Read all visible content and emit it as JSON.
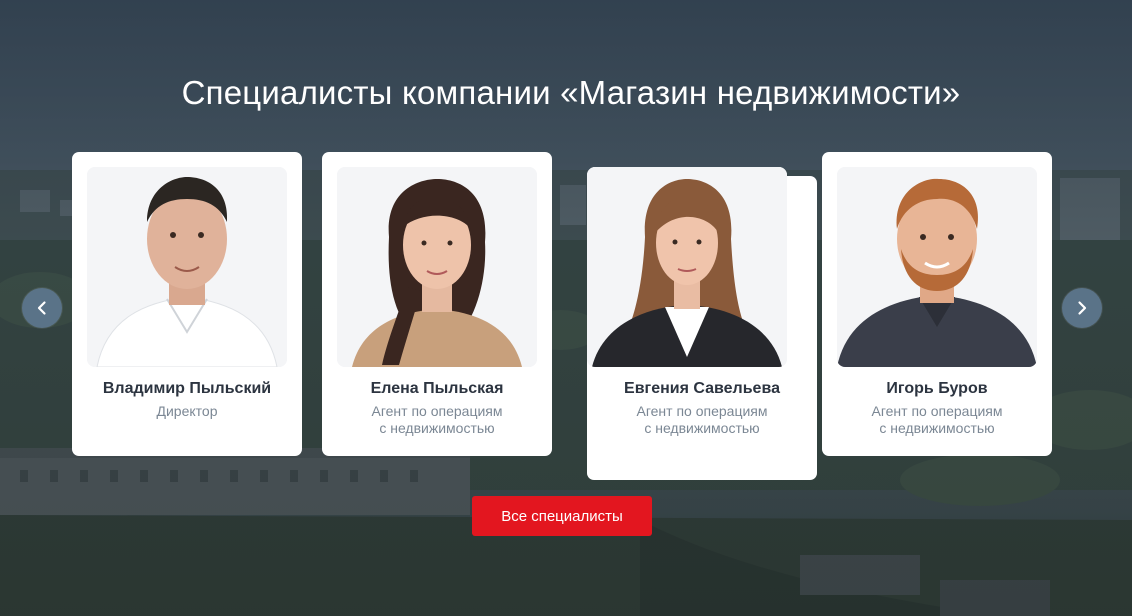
{
  "section": {
    "title": "Специалисты компании «Магазин недвижимости»"
  },
  "specialists": [
    {
      "name": "Владимир Пыльский",
      "role_line1": "Директор",
      "role_line2": ""
    },
    {
      "name": "Елена Пыльская",
      "role_line1": "Агент по операциям",
      "role_line2": "с недвижимостью"
    },
    {
      "name": "Евгения Савельева",
      "role_line1": "Агент по операциям",
      "role_line2": "с недвижимостью"
    },
    {
      "name": "Игорь Буров",
      "role_line1": "Агент по операциям",
      "role_line2": "с недвижимостью"
    }
  ],
  "carousel": {
    "prev_icon": "chevron-left-icon",
    "next_icon": "chevron-right-icon"
  },
  "cta": {
    "label": "Все специалисты"
  },
  "colors": {
    "accent": "#e3161f",
    "card_bg": "#ffffff",
    "nav_bg": "#5a7388",
    "name_text": "#2c3440",
    "role_text": "#7b8794"
  }
}
